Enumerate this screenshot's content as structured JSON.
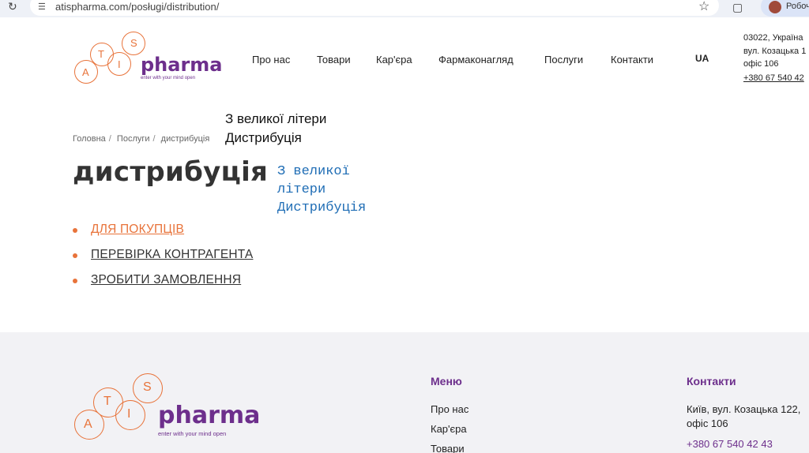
{
  "browser": {
    "url": "atispharma.com/posługi/distribution/",
    "profile_label": "Робоч"
  },
  "logo": {
    "letters": [
      "A",
      "T",
      "I",
      "S"
    ],
    "name": "pharma",
    "tagline": "enter with your mind open"
  },
  "nav": {
    "items": [
      "Про нас",
      "Товари",
      "Кар'єра",
      "Фармаконагляд",
      "Послуги",
      "Контакти"
    ],
    "lang": "UA"
  },
  "contact_top": {
    "address_lines": [
      "03022, Україна",
      "вул. Козацька 1",
      "офіс 106"
    ],
    "phone": "+380 67 540 42"
  },
  "breadcrumb": [
    "Головна",
    "Послуги",
    "дистрибуція"
  ],
  "page_title": "дистрибуція",
  "annotations": {
    "note1_lines": [
      "З великої літери",
      "Дистрибуція"
    ],
    "note2_lines": [
      "З великої",
      "літери",
      "Дистрибуція"
    ]
  },
  "links": [
    "ДЛЯ ПОКУПЦІВ",
    "ПЕРЕВІРКА КОНТРАГЕНТА",
    "ЗРОБИТИ ЗАМОВЛЕННЯ"
  ],
  "footer": {
    "menu_heading": "Меню",
    "menu_items": [
      "Про нас",
      "Кар'єра",
      "Товари"
    ],
    "contacts_heading": "Контакти",
    "address": "Київ, вул. Козацька 122, офіс 106",
    "phone": "+380 67 540 42 43"
  },
  "colors": {
    "brand_orange": "#e8733a",
    "brand_purple": "#6d2f8c",
    "annotation_blue": "#1f6db5"
  }
}
